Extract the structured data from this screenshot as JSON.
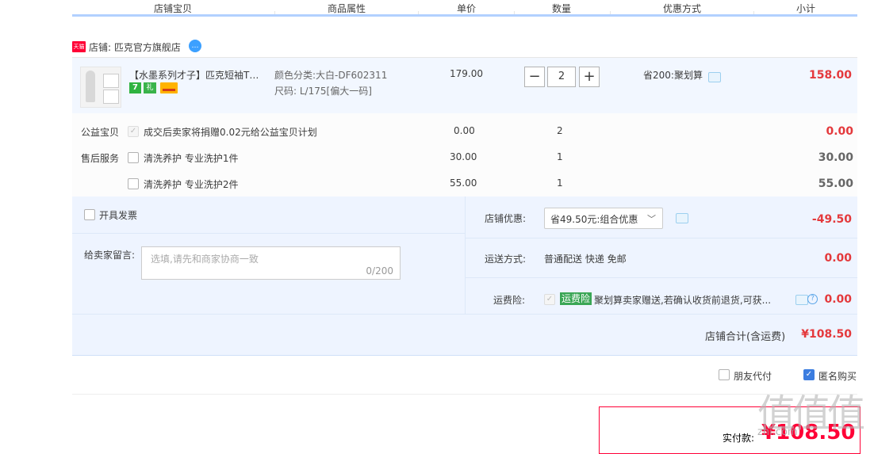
{
  "header": {
    "columns": [
      "店铺宝贝",
      "商品属性",
      "单价",
      "数量",
      "优惠方式",
      "小计"
    ]
  },
  "shop": {
    "logo_text": "天猫",
    "label": "店铺:",
    "name": "匹克官方旗舰店",
    "msg_icon": "chat-bubble-icon"
  },
  "item": {
    "title": "【水墨系列才子】匹克短袖T恤男",
    "badge_7": "7",
    "badge_gift": "礼",
    "color_label": "颜色分类:",
    "color_value": "大白-DF602311",
    "size_label": "尺码:",
    "size_value": "L/175[偏大一码]",
    "price": "179.00",
    "qty_minus": "−",
    "qty": "2",
    "qty_plus": "+",
    "promo": "省200:聚划算",
    "subtotal": "158.00"
  },
  "charity": {
    "label": "公益宝贝",
    "text": "成交后卖家将捐赠0.02元给公益宝贝计划",
    "price": "0.00",
    "qty": "2",
    "subtotal": "0.00"
  },
  "after_sales": {
    "label": "售后服务",
    "options": [
      {
        "text": "清洗养护 专业洗护1件",
        "price": "30.00",
        "qty": "1",
        "subtotal": "30.00"
      },
      {
        "text": "清洗养护 专业洗护2件",
        "price": "55.00",
        "qty": "1",
        "subtotal": "55.00"
      }
    ]
  },
  "invoice": {
    "label": "开具发票"
  },
  "message": {
    "label": "给卖家留言:",
    "placeholder": "选填,请先和商家协商一致",
    "count": "0/200"
  },
  "shop_discount": {
    "label": "店铺优惠:",
    "selected": "省49.50元:组合优惠",
    "amount": "-49.50"
  },
  "shipping": {
    "label": "运送方式:",
    "value": "普通配送 快递 免邮",
    "amount": "0.00"
  },
  "insurance": {
    "label": "运费险:",
    "tag": "运费险",
    "text": "聚划算卖家赠送,若确认收货前退货,可获...",
    "amount": "0.00"
  },
  "shop_total": {
    "label": "店铺合计(含运费)",
    "amount": "¥108.50"
  },
  "options": {
    "friend_pay": "朋友代付",
    "anonymous": "匿名购买"
  },
  "pay": {
    "label": "实付款:",
    "amount": "¥108.50"
  },
  "watermark": {
    "text": "值值值",
    "url": "zhi.com"
  },
  "colors": {
    "accent_red": "#ff0036",
    "amount_red": "#e4393c",
    "header_line": "#b2d1ff",
    "row_bg": "#f2f7ff"
  }
}
